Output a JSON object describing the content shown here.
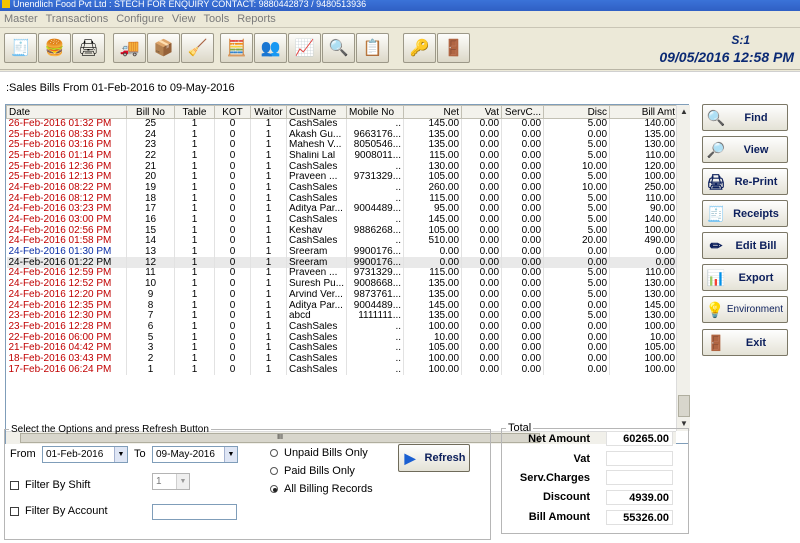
{
  "window": {
    "title": "Unendlich Food Pvt Ltd   : STECH FOR ENQUIRY CONTACT: 9880442873 / 9480513936"
  },
  "menu": [
    "Master",
    "Transactions",
    "Configure",
    "View",
    "Tools",
    "Reports"
  ],
  "toolbar_icons": [
    "pos-icon",
    "burger-icon",
    "printer-icon",
    "truck-icon",
    "boxes-icon",
    "stamp-icon",
    "calculator-icon",
    "users-icon",
    "chart-icon",
    "search-icon",
    "report-icon",
    "key-icon",
    "exit-icon"
  ],
  "status": {
    "session": "S:1",
    "datetime": "09/05/2016 12:58 PM"
  },
  "page": {
    "header": ":Sales Bills   From 01-Feb-2016 to 09-May-2016"
  },
  "grid": {
    "columns": [
      "Date",
      "Bill No",
      "Table",
      "KOT",
      "Waitor",
      "CustName",
      "Mobile No",
      "Net",
      "Vat",
      "ServC...",
      "Disc",
      "Bill Amt"
    ],
    "rows": [
      {
        "date": "26-Feb-2016  01:32 PM",
        "bill": "25",
        "table": "1",
        "kot": "0",
        "waitor": "1",
        "cust": "CashSales",
        "mobile": "..",
        "net": "145.00",
        "vat": "0.00",
        "serv": "0.00",
        "disc": "5.00",
        "amt": "140.00",
        "color": "red"
      },
      {
        "date": "25-Feb-2016  08:33 PM",
        "bill": "24",
        "table": "1",
        "kot": "0",
        "waitor": "1",
        "cust": "Akash Gu...",
        "mobile": "9663176...",
        "net": "135.00",
        "vat": "0.00",
        "serv": "0.00",
        "disc": "0.00",
        "amt": "135.00",
        "color": "red"
      },
      {
        "date": "25-Feb-2016  03:16 PM",
        "bill": "23",
        "table": "1",
        "kot": "0",
        "waitor": "1",
        "cust": "Mahesh V...",
        "mobile": "8050546...",
        "net": "135.00",
        "vat": "0.00",
        "serv": "0.00",
        "disc": "5.00",
        "amt": "130.00",
        "color": "red"
      },
      {
        "date": "25-Feb-2016  01:14 PM",
        "bill": "22",
        "table": "1",
        "kot": "0",
        "waitor": "1",
        "cust": "Shalini Lal",
        "mobile": "9008011...",
        "net": "115.00",
        "vat": "0.00",
        "serv": "0.00",
        "disc": "5.00",
        "amt": "110.00",
        "color": "red"
      },
      {
        "date": "25-Feb-2016  12:36 PM",
        "bill": "21",
        "table": "1",
        "kot": "0",
        "waitor": "1",
        "cust": "CashSales",
        "mobile": "..",
        "net": "130.00",
        "vat": "0.00",
        "serv": "0.00",
        "disc": "10.00",
        "amt": "120.00",
        "color": "red"
      },
      {
        "date": "25-Feb-2016  12:13 PM",
        "bill": "20",
        "table": "1",
        "kot": "0",
        "waitor": "1",
        "cust": "Praveen ...",
        "mobile": "9731329...",
        "net": "105.00",
        "vat": "0.00",
        "serv": "0.00",
        "disc": "5.00",
        "amt": "100.00",
        "color": "red"
      },
      {
        "date": "24-Feb-2016  08:22 PM",
        "bill": "19",
        "table": "1",
        "kot": "0",
        "waitor": "1",
        "cust": "CashSales",
        "mobile": "..",
        "net": "260.00",
        "vat": "0.00",
        "serv": "0.00",
        "disc": "10.00",
        "amt": "250.00",
        "color": "red"
      },
      {
        "date": "24-Feb-2016  08:12 PM",
        "bill": "18",
        "table": "1",
        "kot": "0",
        "waitor": "1",
        "cust": "CashSales",
        "mobile": "..",
        "net": "115.00",
        "vat": "0.00",
        "serv": "0.00",
        "disc": "5.00",
        "amt": "110.00",
        "color": "red"
      },
      {
        "date": "24-Feb-2016  03:23 PM",
        "bill": "17",
        "table": "1",
        "kot": "0",
        "waitor": "1",
        "cust": "Aditya Par...",
        "mobile": "9004489...",
        "net": "95.00",
        "vat": "0.00",
        "serv": "0.00",
        "disc": "5.00",
        "amt": "90.00",
        "color": "red"
      },
      {
        "date": "24-Feb-2016  03:00 PM",
        "bill": "16",
        "table": "1",
        "kot": "0",
        "waitor": "1",
        "cust": "CashSales",
        "mobile": "..",
        "net": "145.00",
        "vat": "0.00",
        "serv": "0.00",
        "disc": "5.00",
        "amt": "140.00",
        "color": "red"
      },
      {
        "date": "24-Feb-2016  02:56 PM",
        "bill": "15",
        "table": "1",
        "kot": "0",
        "waitor": "1",
        "cust": "Keshav",
        "mobile": "9886268...",
        "net": "105.00",
        "vat": "0.00",
        "serv": "0.00",
        "disc": "5.00",
        "amt": "100.00",
        "color": "red"
      },
      {
        "date": "24-Feb-2016  01:58 PM",
        "bill": "14",
        "table": "1",
        "kot": "0",
        "waitor": "1",
        "cust": "CashSales",
        "mobile": "..",
        "net": "510.00",
        "vat": "0.00",
        "serv": "0.00",
        "disc": "20.00",
        "amt": "490.00",
        "color": "red"
      },
      {
        "date": "24-Feb-2016  01:30 PM",
        "bill": "13",
        "table": "1",
        "kot": "0",
        "waitor": "1",
        "cust": "Sreeram",
        "mobile": "9900176...",
        "net": "0.00",
        "vat": "0.00",
        "serv": "0.00",
        "disc": "0.00",
        "amt": "0.00",
        "color": "blue"
      },
      {
        "date": "24-Feb-2016  01:22 PM",
        "bill": "12",
        "table": "1",
        "kot": "0",
        "waitor": "1",
        "cust": "Sreeram",
        "mobile": "9900176...",
        "net": "0.00",
        "vat": "0.00",
        "serv": "0.00",
        "disc": "0.00",
        "amt": "0.00",
        "color": "blk",
        "selected": true
      },
      {
        "date": "24-Feb-2016  12:59 PM",
        "bill": "11",
        "table": "1",
        "kot": "0",
        "waitor": "1",
        "cust": "Praveen ...",
        "mobile": "9731329...",
        "net": "115.00",
        "vat": "0.00",
        "serv": "0.00",
        "disc": "5.00",
        "amt": "110.00",
        "color": "red"
      },
      {
        "date": "24-Feb-2016  12:52 PM",
        "bill": "10",
        "table": "1",
        "kot": "0",
        "waitor": "1",
        "cust": "Suresh Pu...",
        "mobile": "9008668...",
        "net": "135.00",
        "vat": "0.00",
        "serv": "0.00",
        "disc": "5.00",
        "amt": "130.00",
        "color": "red"
      },
      {
        "date": "24-Feb-2016  12:20 PM",
        "bill": "9",
        "table": "1",
        "kot": "0",
        "waitor": "1",
        "cust": "Arvind Ver...",
        "mobile": "9873761...",
        "net": "135.00",
        "vat": "0.00",
        "serv": "0.00",
        "disc": "5.00",
        "amt": "130.00",
        "color": "red"
      },
      {
        "date": "24-Feb-2016  12:35 PM",
        "bill": "8",
        "table": "1",
        "kot": "0",
        "waitor": "1",
        "cust": "Aditya Par...",
        "mobile": "9004489...",
        "net": "145.00",
        "vat": "0.00",
        "serv": "0.00",
        "disc": "0.00",
        "amt": "145.00",
        "color": "red"
      },
      {
        "date": "23-Feb-2016  12:30 PM",
        "bill": "7",
        "table": "1",
        "kot": "0",
        "waitor": "1",
        "cust": "abcd",
        "mobile": "1111111...",
        "net": "135.00",
        "vat": "0.00",
        "serv": "0.00",
        "disc": "5.00",
        "amt": "130.00",
        "color": "red"
      },
      {
        "date": "23-Feb-2016  12:28 PM",
        "bill": "6",
        "table": "1",
        "kot": "0",
        "waitor": "1",
        "cust": "CashSales",
        "mobile": "..",
        "net": "100.00",
        "vat": "0.00",
        "serv": "0.00",
        "disc": "0.00",
        "amt": "100.00",
        "color": "red"
      },
      {
        "date": "22-Feb-2016  06:00 PM",
        "bill": "5",
        "table": "1",
        "kot": "0",
        "waitor": "1",
        "cust": "CashSales",
        "mobile": "..",
        "net": "10.00",
        "vat": "0.00",
        "serv": "0.00",
        "disc": "0.00",
        "amt": "10.00",
        "color": "red"
      },
      {
        "date": "21-Feb-2016  04:42 PM",
        "bill": "3",
        "table": "1",
        "kot": "0",
        "waitor": "1",
        "cust": "CashSales",
        "mobile": "..",
        "net": "105.00",
        "vat": "0.00",
        "serv": "0.00",
        "disc": "0.00",
        "amt": "105.00",
        "color": "red"
      },
      {
        "date": "18-Feb-2016  03:43 PM",
        "bill": "2",
        "table": "1",
        "kot": "0",
        "waitor": "1",
        "cust": "CashSales",
        "mobile": "..",
        "net": "100.00",
        "vat": "0.00",
        "serv": "0.00",
        "disc": "0.00",
        "amt": "100.00",
        "color": "red"
      },
      {
        "date": "17-Feb-2016  06:24 PM",
        "bill": "1",
        "table": "1",
        "kot": "0",
        "waitor": "1",
        "cust": "CashSales",
        "mobile": "..",
        "net": "100.00",
        "vat": "0.00",
        "serv": "0.00",
        "disc": "0.00",
        "amt": "100.00",
        "color": "red"
      }
    ]
  },
  "side_buttons": [
    {
      "name": "find-button",
      "label": "Find",
      "icon": "magnifier-icon",
      "glyph": "🔍"
    },
    {
      "name": "view-button",
      "label": "View",
      "icon": "preview-icon",
      "glyph": "🔎"
    },
    {
      "name": "reprint-button",
      "label": "Re-Print",
      "icon": "printer-icon",
      "glyph": "🖨"
    },
    {
      "name": "receipts-button",
      "label": "Receipts",
      "icon": "receipt-icon",
      "glyph": "🧾"
    },
    {
      "name": "edit-bill-button",
      "label": "Edit Bill",
      "icon": "pencil-icon",
      "glyph": "✏"
    },
    {
      "name": "export-button",
      "label": "Export",
      "icon": "spreadsheet-icon",
      "glyph": "📊"
    },
    {
      "name": "environment-button",
      "label": "Environment",
      "icon": "bulb-icon",
      "glyph": "💡"
    },
    {
      "name": "exit-button",
      "label": "Exit",
      "icon": "exit-door-icon",
      "glyph": "🚪"
    }
  ],
  "options": {
    "legend": "Select the Options and press Refresh Button",
    "from_label": "From",
    "from_value": "01-Feb-2016",
    "to_label": "To",
    "to_value": "09-May-2016",
    "shift_label": "Filter By Shift",
    "shift_value": "1",
    "account_label": "Filter By Account",
    "account_value": "",
    "radio_unpaid": "Unpaid Bills Only",
    "radio_paid": "Paid Bills Only",
    "radio_all": "All Billing Records",
    "refresh_label": "Refresh"
  },
  "totals": {
    "legend": "Total",
    "net_label": "Net Amount",
    "net": "60265.00",
    "vat_label": "Vat",
    "vat": "",
    "serv_label": "Serv.Charges",
    "serv": "",
    "disc_label": "Discount",
    "disc": "4939.00",
    "bill_label": "Bill  Amount",
    "bill": "55326.00"
  },
  "colors": {
    "red_rows": "#c00000",
    "blue_rows": "#0a2ea6",
    "accent": "#0b2a74"
  }
}
